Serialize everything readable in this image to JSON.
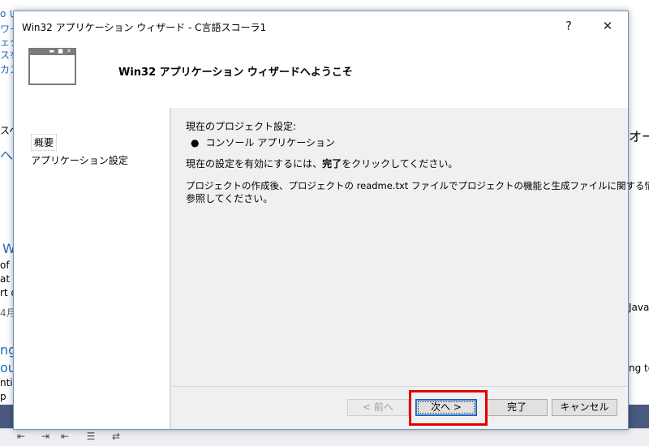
{
  "background": {
    "frag_top_1": "o い…",
    "frag_wa": "ワー",
    "frag_e": "ェク",
    "frag_su": "スを",
    "frag_ka": "カス",
    "frag_su2": "スペ",
    "frag_no": "への",
    "frag_w": "W",
    "frag_of": "of c",
    "frag_at": "at s",
    "frag_rt": "rt o",
    "frag_4": "4月",
    "frag_ng": "ng",
    "frag_ous": "ous",
    "frag_nti": "nti",
    "frag_p": "p",
    "frag_right_o": "オー",
    "frag_right_java": "JavaS",
    "frag_right_ng": "ng to"
  },
  "dialog": {
    "title": "Win32 アプリケーション ウィザード - C言語スコーラ1",
    "help": "?",
    "close": "✕",
    "header_title": "Win32 アプリケーション ウィザードへようこそ",
    "sidebar": [
      {
        "label": "概要"
      },
      {
        "label": "アプリケーション設定"
      }
    ],
    "content": {
      "current_settings": "現在のプロジェクト設定:",
      "bullet_item": "コンソール アプリケーション",
      "finish_prefix": "現在の設定を有効にするには、",
      "finish_keyword": "完了",
      "finish_suffix": "をクリックしてください。",
      "info_line1": "プロジェクトの作成後、プロジェクトの readme.txt ファイルでプロジェクトの機能と生成ファイルに関する情報を",
      "info_line2": "参照してください。"
    },
    "buttons": {
      "prev": "< 前へ",
      "next": "次へ >",
      "finish": "完了",
      "cancel": "キャンセル"
    }
  },
  "colors": {
    "highlight": "#e00000",
    "link": "#1e6ab8"
  }
}
